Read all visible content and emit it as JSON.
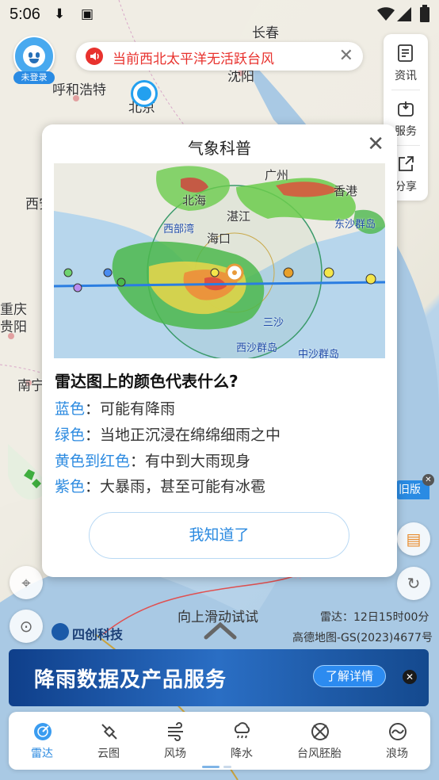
{
  "statusbar": {
    "time": "5:06"
  },
  "map": {
    "labels": [
      "长春",
      "呼和浩特",
      "北京",
      "沈阳",
      "西安",
      "重庆",
      "贵阳",
      "南宁"
    ],
    "radar_time": "雷达：12日15时00分",
    "copyright": "高德地图-GS(2023)4677号",
    "brand": "四创科技",
    "swipe_hint": "向上滑动试试",
    "version_tag": "旧版"
  },
  "user": {
    "login_label": "未登录"
  },
  "alert": {
    "text": "当前西北太平洋无活跃台风"
  },
  "side_menu": [
    {
      "label": "资讯",
      "icon": "news-icon"
    },
    {
      "label": "服务",
      "icon": "service-icon"
    },
    {
      "label": "分享",
      "icon": "share-icon"
    }
  ],
  "dialog": {
    "title": "气象科普",
    "radar_labels": [
      "北海",
      "广州",
      "香港",
      "湛江",
      "海口",
      "东沙群岛",
      "三沙",
      "西沙群岛",
      "中沙群岛",
      "西部湾"
    ],
    "question": "雷达图上的颜色代表什么?",
    "items": [
      {
        "key": "蓝色",
        "value": "：可能有降雨"
      },
      {
        "key": "绿色",
        "value": "：当地正沉浸在绵绵细雨之中"
      },
      {
        "key": "黄色到红色",
        "value": "：有中到大雨现身"
      },
      {
        "key": "紫色",
        "value": "：大暴雨，甚至可能有冰雹"
      }
    ],
    "ok_label": "我知道了"
  },
  "banner": {
    "title": "降雨数据及产品服务",
    "cta": "了解详情"
  },
  "tabs": [
    {
      "label": "雷达",
      "icon": "radar-icon"
    },
    {
      "label": "云图",
      "icon": "satellite-icon"
    },
    {
      "label": "风场",
      "icon": "wind-icon"
    },
    {
      "label": "降水",
      "icon": "rain-icon"
    },
    {
      "label": "台风胚胎",
      "icon": "typhoon-icon"
    },
    {
      "label": "浪场",
      "icon": "wave-icon"
    }
  ],
  "colors": {
    "accent": "#2b8ae0",
    "alert": "#e8322e",
    "banner": "#1b5aa8"
  }
}
